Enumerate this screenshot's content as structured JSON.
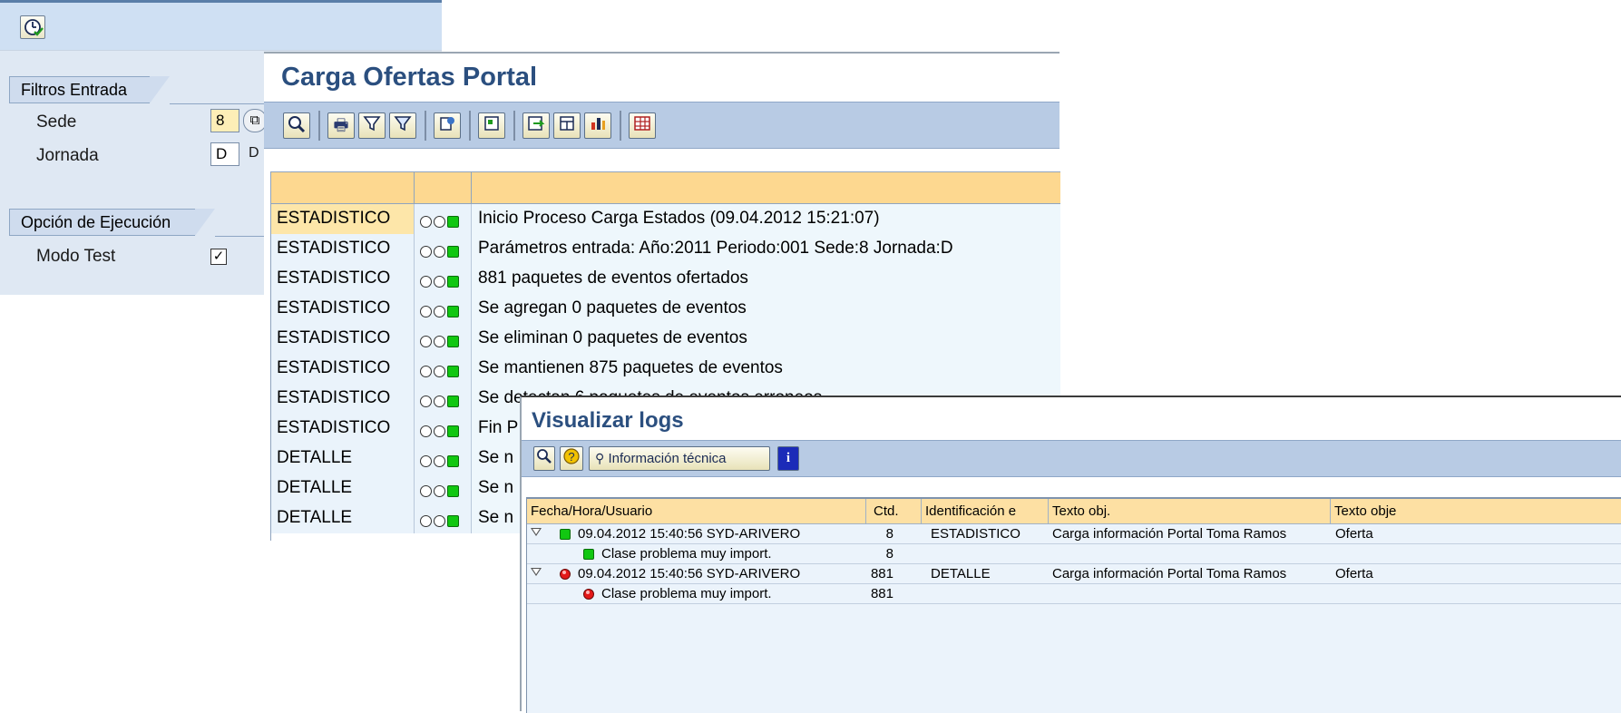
{
  "selection_screen": {
    "groups": [
      {
        "title": "Filtros Entrada"
      },
      {
        "title": "Opción de Ejecución"
      }
    ],
    "fields": {
      "sede_label": "Sede",
      "sede_value": "8",
      "jornada_label": "Jornada",
      "jornada_value": "D",
      "jornada_desc": "D",
      "modo_test_label": "Modo Test",
      "modo_test_checked": "✓"
    }
  },
  "alv_window": {
    "title": "Carga Ofertas Portal",
    "rows": [
      {
        "type": "ESTADISTICO",
        "text": "Inicio Proceso Carga Estados (09.04.2012 15:21:07)",
        "light": "green",
        "selected": true
      },
      {
        "type": "ESTADISTICO",
        "text": "Parámetros entrada: Año:2011 Periodo:001 Sede:8 Jornada:D",
        "light": "green"
      },
      {
        "type": "ESTADISTICO",
        "text": "881 paquetes de eventos ofertados",
        "light": "green"
      },
      {
        "type": "ESTADISTICO",
        "text": "Se agregan 0 paquetes de eventos",
        "light": "green"
      },
      {
        "type": "ESTADISTICO",
        "text": "Se eliminan 0 paquetes de eventos",
        "light": "green"
      },
      {
        "type": "ESTADISTICO",
        "text": "Se mantienen 875 paquetes de eventos",
        "light": "green"
      },
      {
        "type": "ESTADISTICO",
        "text": "Se detectan 6 paquetes de eventos erroneos",
        "light": "green"
      },
      {
        "type": "ESTADISTICO",
        "text": "Fin P",
        "light": "green"
      },
      {
        "type": "DETALLE",
        "text": "Se n",
        "light": "green"
      },
      {
        "type": "DETALLE",
        "text": "Se n",
        "light": "green"
      },
      {
        "type": "DETALLE",
        "text": "Se n",
        "light": "green"
      }
    ]
  },
  "log_window": {
    "title": "Visualizar logs",
    "toolbar": {
      "tech_info_label": "Información técnica"
    },
    "columns": [
      "Fecha/Hora/Usuario",
      "Ctd.",
      "Identificación e",
      "Texto obj.",
      "Texto obje"
    ],
    "rows": [
      {
        "indent": 0,
        "expand": true,
        "icon": "green",
        "col1": "09.04.2012  15:40:56  SYD-ARIVERO",
        "ctd": "8",
        "ident": "ESTADISTICO",
        "texto": "Carga información Portal Toma Ramos",
        "texto2": "Oferta"
      },
      {
        "indent": 1,
        "expand": false,
        "icon": "green",
        "col1": "Clase problema muy import.",
        "ctd": "8",
        "ident": "",
        "texto": "",
        "texto2": ""
      },
      {
        "indent": 0,
        "expand": true,
        "icon": "red",
        "col1": "09.04.2012  15:40:56  SYD-ARIVERO",
        "ctd": "881",
        "ident": "DETALLE",
        "texto": "Carga información Portal Toma Ramos",
        "texto2": "Oferta"
      },
      {
        "indent": 1,
        "expand": false,
        "icon": "red",
        "col1": "Clase problema muy import.",
        "ctd": "881",
        "ident": "",
        "texto": "",
        "texto2": ""
      }
    ]
  }
}
